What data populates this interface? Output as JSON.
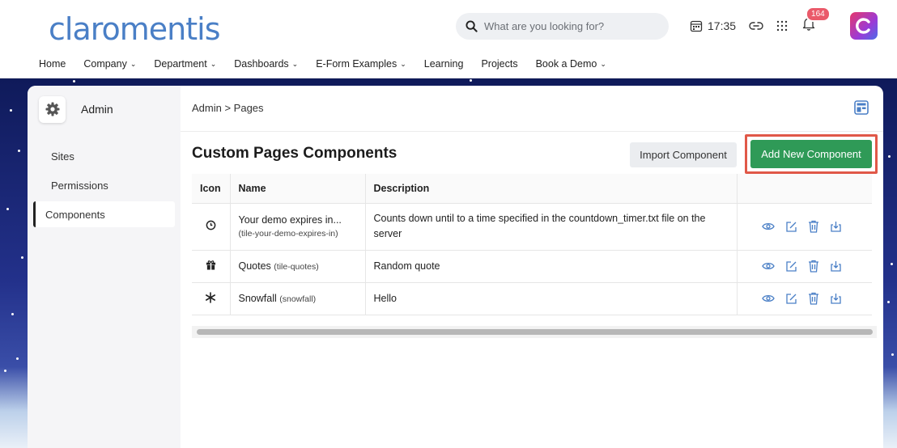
{
  "header": {
    "logo": "claromentis",
    "search_placeholder": "What are you looking for?",
    "time": "17:35",
    "notification_count": "164"
  },
  "nav": [
    {
      "label": "Home",
      "has_dropdown": false
    },
    {
      "label": "Company",
      "has_dropdown": true
    },
    {
      "label": "Department",
      "has_dropdown": true
    },
    {
      "label": "Dashboards",
      "has_dropdown": true
    },
    {
      "label": "E-Form Examples",
      "has_dropdown": true
    },
    {
      "label": "Learning",
      "has_dropdown": false
    },
    {
      "label": "Projects",
      "has_dropdown": false
    },
    {
      "label": "Book a Demo",
      "has_dropdown": true
    }
  ],
  "sidebar": {
    "title": "Admin",
    "items": [
      {
        "label": "Sites"
      },
      {
        "label": "Permissions"
      },
      {
        "label": "Components",
        "active": true
      }
    ]
  },
  "main": {
    "breadcrumb": "Admin > Pages",
    "title": "Custom Pages Components",
    "import_button": "Import Component",
    "add_button": "Add New Component",
    "columns": [
      "Icon",
      "Name",
      "Description",
      ""
    ],
    "rows": [
      {
        "icon": "clock-icon",
        "name": "Your demo expires in...",
        "slug": "(tile-your-demo-expires-in)",
        "description": "Counts down until to a time specified in the countdown_timer.txt file on the server"
      },
      {
        "icon": "gift-icon",
        "name": "Quotes",
        "slug": "(tile-quotes)",
        "description": "Random quote"
      },
      {
        "icon": "snowflake-icon",
        "name": "Snowfall",
        "slug": "(snowfall)",
        "description": "Hello"
      }
    ]
  },
  "colors": {
    "brand": "#4a7fc6",
    "primary_button": "#2f9a57",
    "highlight": "#e05848",
    "badge": "#ea5a6a"
  }
}
